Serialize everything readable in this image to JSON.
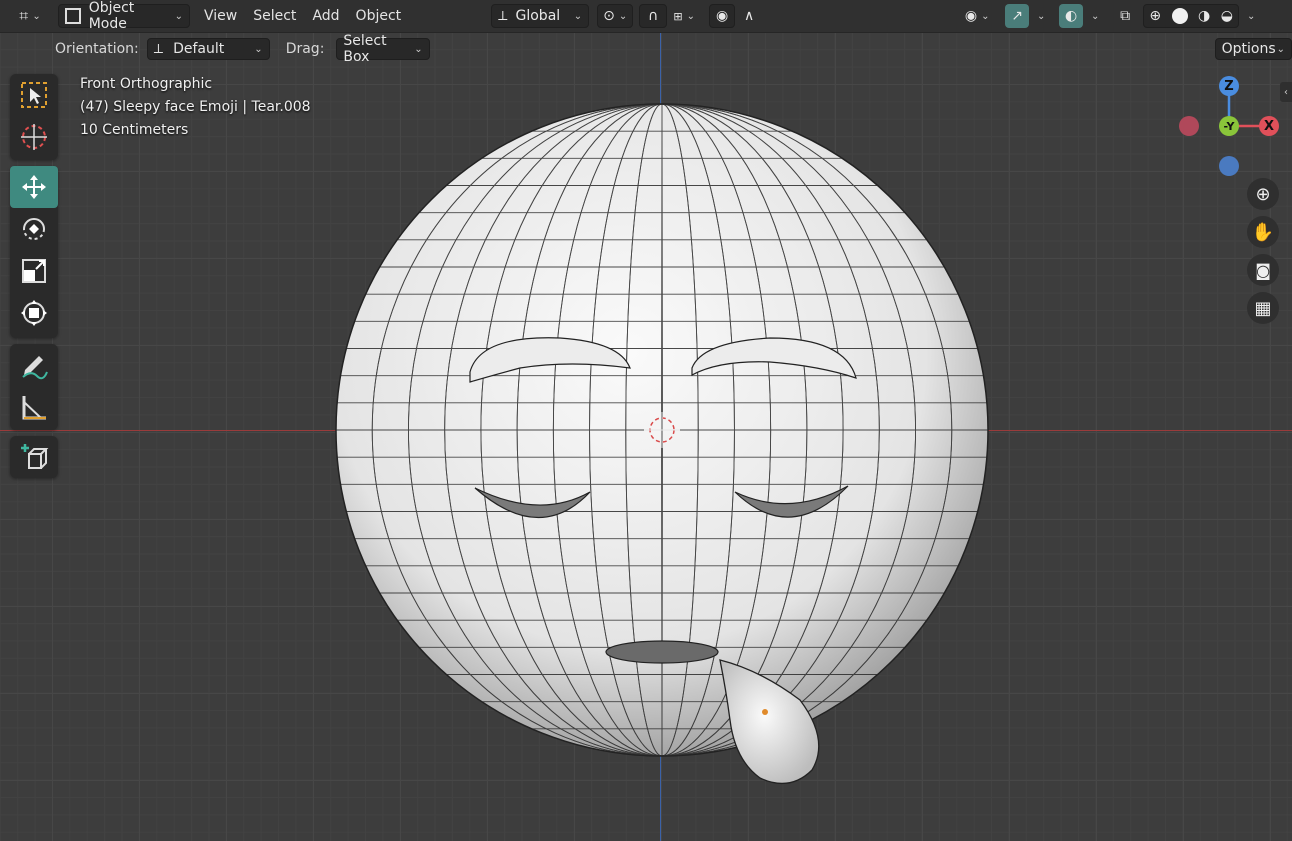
{
  "header": {
    "mode_label": "Object Mode",
    "menus": [
      "View",
      "Select",
      "Add",
      "Object"
    ],
    "transform_orientation": "Global"
  },
  "subbar": {
    "orientation_label": "Orientation:",
    "orientation_value": "Default",
    "drag_label": "Drag:",
    "drag_value": "Select Box",
    "options_label": "Options"
  },
  "overlay": {
    "view_name": "Front Orthographic",
    "object_info": "(47) Sleepy face Emoji | Tear.008",
    "grid_scale": "10 Centimeters"
  },
  "gizmo": {
    "z_label": "Z",
    "y_label": "-Y",
    "x_label": "X"
  },
  "tools": [
    "select-box-icon",
    "cursor-icon",
    "move-icon",
    "rotate-icon",
    "scale-icon",
    "transform-icon",
    "annotate-icon",
    "measure-icon",
    "add-cube-icon"
  ],
  "colors": {
    "accent": "#3f8a80",
    "axis_x": "#9a3b3b",
    "axis_z": "#3b62a8",
    "gizmo_x": "#e0505a",
    "gizmo_y": "#8ac53a",
    "gizmo_z": "#4a8de0"
  }
}
